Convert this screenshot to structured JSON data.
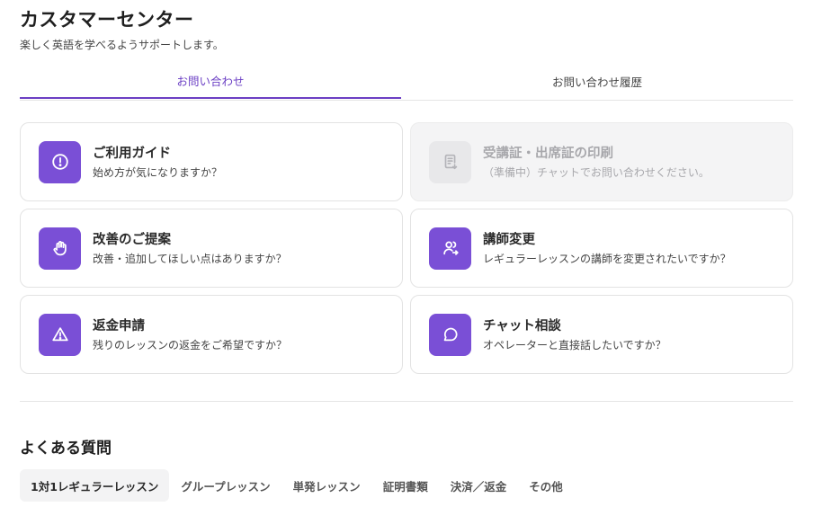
{
  "header": {
    "title": "カスタマーセンター",
    "subtitle": "楽しく英語を学べるようサポートします。"
  },
  "tabs": [
    {
      "label": "お問い合わせ",
      "active": true
    },
    {
      "label": "お問い合わせ履歴",
      "active": false
    }
  ],
  "cards": {
    "guide": {
      "title": "ご利用ガイド",
      "desc": "始め方が気になりますか？",
      "icon": "exclamation-circle-icon"
    },
    "certificate": {
      "title": "受講証・出席証の印刷",
      "desc": "（準備中）チャットでお問い合わせください。",
      "icon": "document-download-icon",
      "disabled": true
    },
    "suggestion": {
      "title": "改善のご提案",
      "desc": "改善・追加してほしい点はありますか？",
      "icon": "hand-icon"
    },
    "tutor_change": {
      "title": "講師変更",
      "desc": "レギュラーレッスンの講師を変更されたいですか？",
      "icon": "user-switch-icon"
    },
    "refund": {
      "title": "返金申請",
      "desc": "残りのレッスンの返金をご希望ですか？",
      "icon": "warning-triangle-icon"
    },
    "chat": {
      "title": "チャット相談",
      "desc": "オペレーターと直接話したいですか？",
      "icon": "chat-bubble-icon"
    }
  },
  "faq": {
    "title": "よくある質問",
    "tabs": [
      {
        "label": "1対1レギュラーレッスン",
        "active": true
      },
      {
        "label": "グループレッスン",
        "active": false
      },
      {
        "label": "単発レッスン",
        "active": false
      },
      {
        "label": "証明書類",
        "active": false
      },
      {
        "label": "決済／返金",
        "active": false
      },
      {
        "label": "その他",
        "active": false
      }
    ]
  },
  "colors": {
    "accent": "#6b3fc4",
    "icon_bg": "#7a4fd6",
    "disabled_bg": "#f4f4f5"
  }
}
